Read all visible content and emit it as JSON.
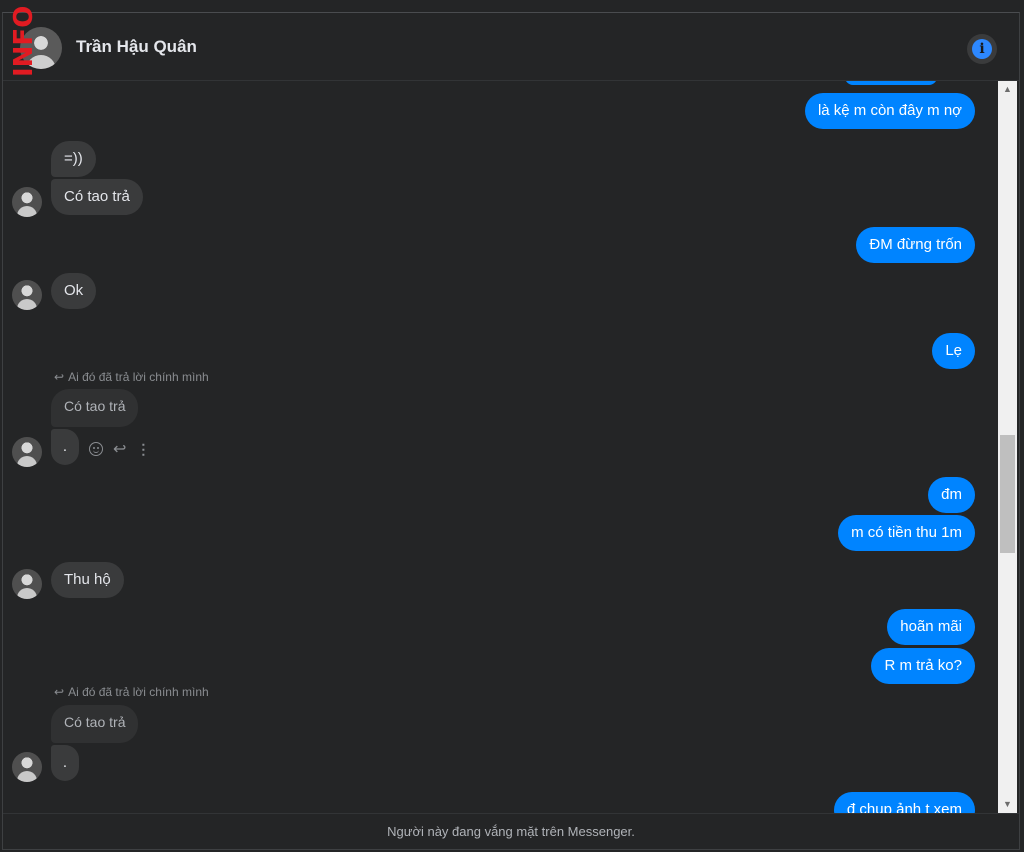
{
  "header": {
    "brand_text": "INFO",
    "contact_name": "Trần Hậu Quân",
    "info_icon_glyph": "i"
  },
  "messages": {
    "out_partial_top": "",
    "out1": "là kệ m còn đây m nợ",
    "in1": "=))",
    "in2": "Có tao trả",
    "out2": "ĐM đừng trốn",
    "in3": "Ok",
    "out3": "Lẹ",
    "reply_note1": "Ai đó đã trả lời chính mình",
    "reply_quote1": "Có tao trả",
    "in4": ".",
    "out4": "đm",
    "out5": "m có tiền thu 1m",
    "in5": "Thu hộ",
    "out6": "hoãn mãi",
    "out7": "R m trả ko?",
    "reply_note2": "Ai đó đã trả lời chính mình",
    "reply_quote2": "Có tao trả",
    "in6": ".",
    "out8": "đ chụp ảnh t xem"
  },
  "icons": {
    "reply_arrow": "↩",
    "react": "emoji-icon",
    "reply": "↩",
    "more": "⋮",
    "scroll_up": "▲",
    "scroll_down": "▼"
  },
  "footer": {
    "status": "Người này đang vắng mặt trên Messenger."
  },
  "colors": {
    "background": "#242526",
    "incoming_bubble": "#3a3b3c",
    "outgoing_bubble": "#0084ff",
    "accent": "#2d88ff"
  }
}
